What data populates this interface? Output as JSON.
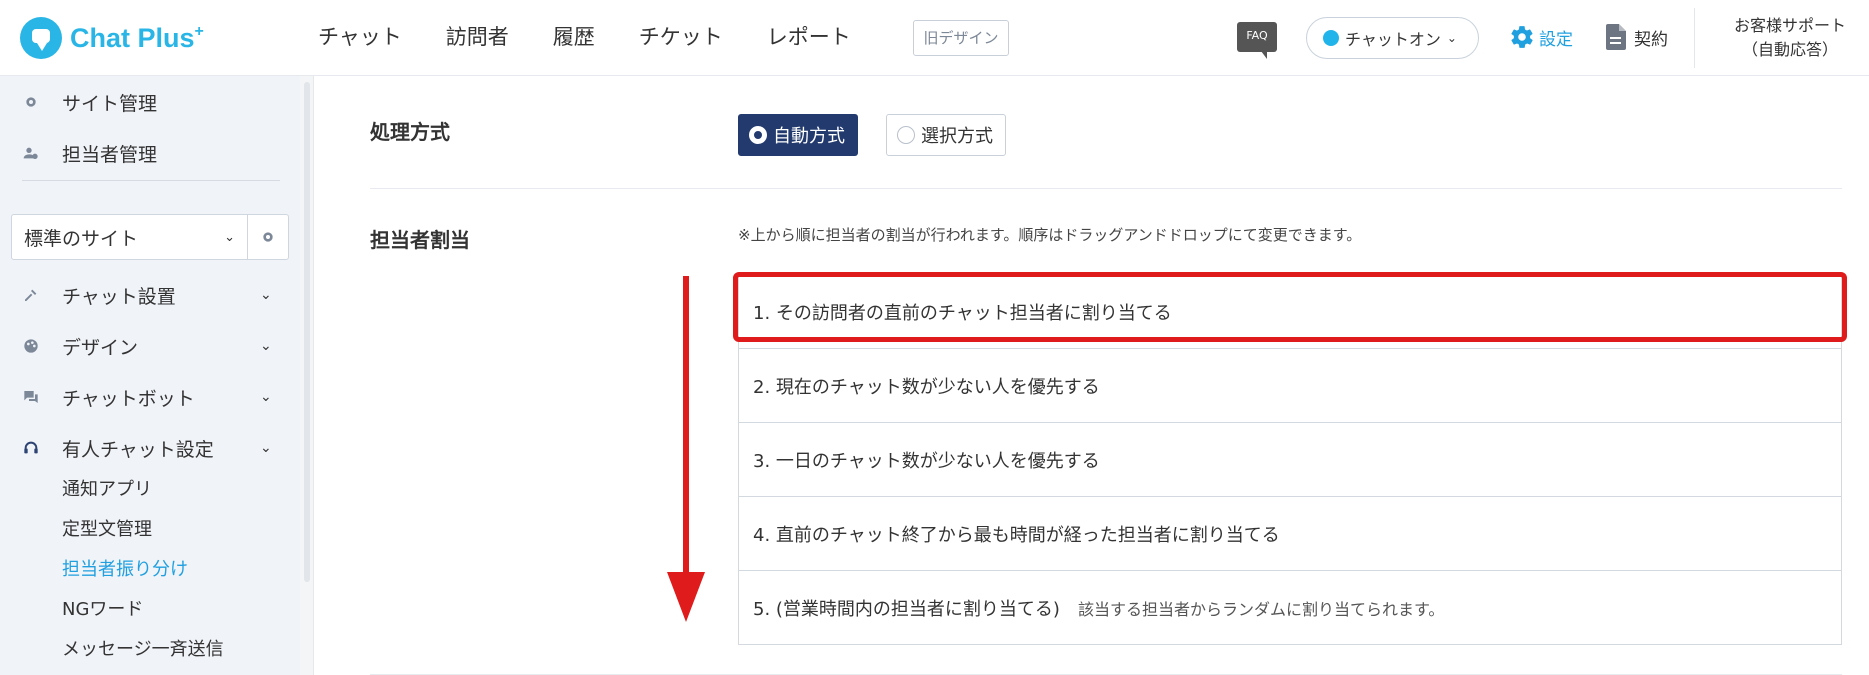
{
  "brand": {
    "name": "Chat Plus",
    "plus_mark": "+"
  },
  "nav": {
    "items": [
      "チャット",
      "訪問者",
      "履歴",
      "チケット",
      "レポート"
    ],
    "old_design": "旧デザイン"
  },
  "header": {
    "faq": "FAQ",
    "chat_status": "チャットオン",
    "settings": "設定",
    "contract": "契約",
    "support_line1": "お客様サポート",
    "support_line2": "（自動応答）"
  },
  "sidebar": {
    "top_items": [
      "サイト管理",
      "担当者管理"
    ],
    "site_select": "標準のサイト",
    "menu": [
      "チャット設置",
      "デザイン",
      "チャットボット",
      "有人チャット設定"
    ],
    "sub_items": [
      "通知アプリ",
      "定型文管理",
      "担当者振り分け",
      "NGワード",
      "メッセージ一斉送信"
    ],
    "active_sub": "担当者振り分け"
  },
  "main": {
    "method_label": "処理方式",
    "method_options": [
      "自動方式",
      "選択方式"
    ],
    "selected_method": "自動方式",
    "assign_label": "担当者割当",
    "note": "※上から順に担当者の割当が行われます。順序はドラッグアンドドロップにて変更できます。",
    "rules": [
      "1. その訪問者の直前のチャット担当者に割り当てる",
      "2. 現在のチャット数が少ない人を優先する",
      "3. 一日のチャット数が少ない人を優先する",
      "4. 直前のチャット終了から最も時間が経った担当者に割り当てる",
      "5. (営業時間内の担当者に割り当てる)"
    ],
    "rule5_sub": "該当する担当者からランダムに割り当てられます。",
    "highlighted_rule": 1
  },
  "colors": {
    "accent": "#21a0e0",
    "selected": "#233a6e",
    "highlight": "#e01b1b"
  }
}
